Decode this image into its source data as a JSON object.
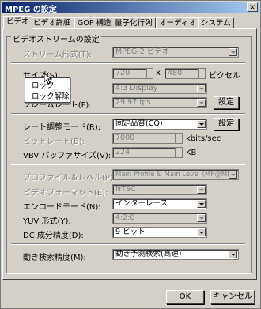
{
  "window": {
    "title": "MPEG の設定",
    "close_glyph": "×"
  },
  "tabs": [
    "ビデオ",
    "ビデオ詳細",
    "GOP 構造",
    "量子化行列",
    "オーディオ",
    "システム"
  ],
  "group_title": "ビデオストリームの設定",
  "stream_format": {
    "label": "ストリーム形式(T):",
    "value": "MPEG-2 ビデオ"
  },
  "size": {
    "label": "サイズ(S):",
    "width": "720",
    "x": "x",
    "height": "480",
    "unit": "ピクセル"
  },
  "aspect": {
    "value": "4:3 Display"
  },
  "frame_rate": {
    "label": "フレームレート(F):",
    "value": "29.97 fps"
  },
  "settings_button": "設定",
  "context_menu": {
    "items": [
      "ロック",
      "ロック解除"
    ]
  },
  "rate_mode": {
    "label": "レート調整モード(R):",
    "value": "固定品質(CQ)"
  },
  "bitrate": {
    "label": "ビットレート(B):",
    "value": "7000",
    "unit": "kbits/sec"
  },
  "vbv": {
    "label": "VBV バッファサイズ(V):",
    "value": "224",
    "unit": "KB"
  },
  "profile": {
    "label": "プロファイル＆レベル(P):",
    "value": "Main Profile & Main Level (MP@ML)"
  },
  "video_format": {
    "label": "ビデオフォーマット(E):",
    "value": "NTSC"
  },
  "encode_mode": {
    "label": "エンコードモード(N):",
    "value": "インターレース"
  },
  "yuv": {
    "label": "YUV 形式(Y):",
    "value": "4:2:0"
  },
  "dc": {
    "label": "DC 成分精度(D):",
    "value": "9 ビット"
  },
  "motion": {
    "label": "動き検索精度(M):",
    "value": "動き予測検索(高速)"
  },
  "ok_button": "OK",
  "cancel_button": "キャンセル"
}
